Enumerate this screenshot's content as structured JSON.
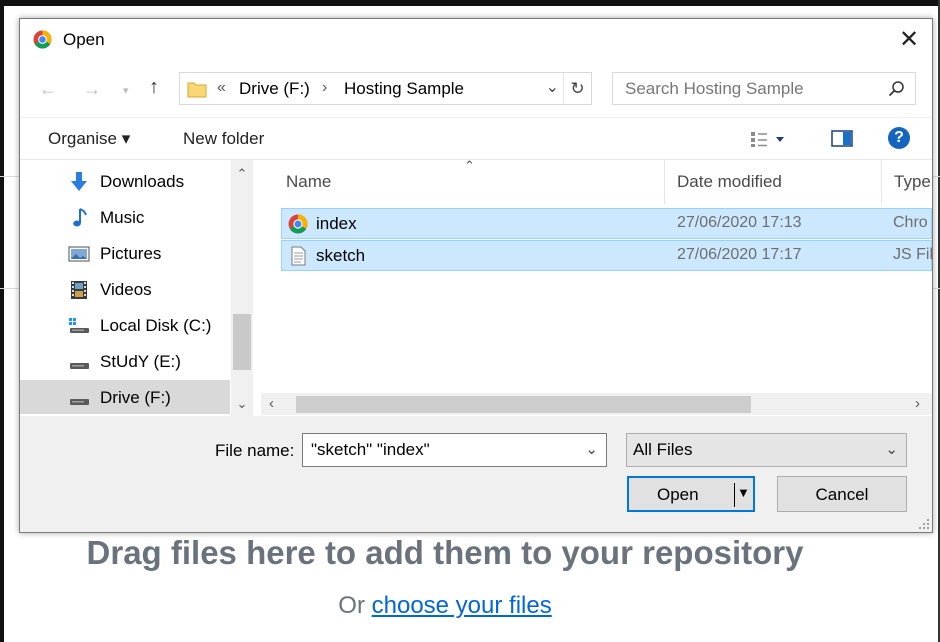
{
  "background_page": {
    "drag_text": "Drag files here to add them to your repository",
    "or_text": "Or",
    "choose_link": "choose your files"
  },
  "dialog": {
    "title": "Open",
    "address": {
      "crumb_overflow": "«",
      "crumbs": [
        "Drive (F:)",
        "Hosting Sample"
      ]
    },
    "search_placeholder": "Search Hosting Sample",
    "toolbar": {
      "organise": "Organise ▾",
      "new_folder": "New folder"
    },
    "nav_items": [
      {
        "label": "Downloads",
        "icon": "download-arrow-icon"
      },
      {
        "label": "Music",
        "icon": "music-note-icon"
      },
      {
        "label": "Pictures",
        "icon": "pictures-icon"
      },
      {
        "label": "Videos",
        "icon": "videos-icon"
      },
      {
        "label": "Local Disk (C:)",
        "icon": "windows-drive-icon"
      },
      {
        "label": "StUdY (E:)",
        "icon": "drive-icon"
      },
      {
        "label": "Drive (F:)",
        "icon": "drive-icon",
        "selected": true
      }
    ],
    "columns": [
      "Name",
      "Date modified",
      "Type"
    ],
    "files": [
      {
        "name": "index",
        "date": "27/06/2020 17:13",
        "type": "Chro",
        "icon": "chrome-html-icon",
        "selected": true
      },
      {
        "name": "sketch",
        "date": "27/06/2020 17:17",
        "type": "JS Fil",
        "icon": "js-file-icon",
        "selected": true
      }
    ],
    "file_name_label": "File name:",
    "file_name_value": "\"sketch\" \"index\"",
    "file_type": "All Files",
    "open_button": "Open",
    "cancel_button": "Cancel",
    "colors": {
      "selection_bg": "#cce8ff",
      "selection_border": "#99d1ff",
      "primary_border": "#0078d7",
      "link": "#0366d6"
    }
  }
}
